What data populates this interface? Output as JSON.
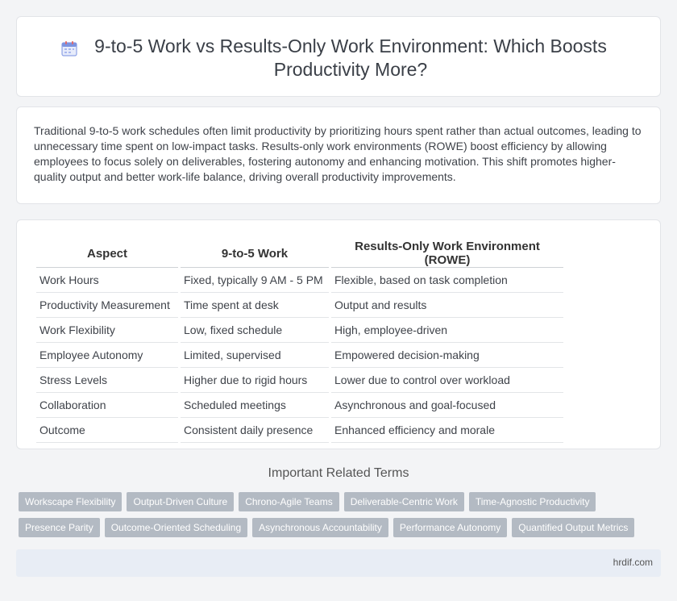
{
  "header": {
    "title": "9-to-5 Work vs Results-Only Work Environment: Which Boosts Productivity More?",
    "icon": "calendar-icon"
  },
  "intro": {
    "text": "Traditional 9-to-5 work schedules often limit productivity by prioritizing hours spent rather than actual outcomes, leading to unnecessary time spent on low-impact tasks. Results-only work environments (ROWE) boost efficiency by allowing employees to focus solely on deliverables, fostering autonomy and enhancing motivation. This shift promotes higher-quality output and better work-life balance, driving overall productivity improvements."
  },
  "table": {
    "headers": [
      "Aspect",
      "9-to-5 Work",
      "Results-Only Work Environment (ROWE)"
    ],
    "rows": [
      [
        "Work Hours",
        "Fixed, typically 9 AM - 5 PM",
        "Flexible, based on task completion"
      ],
      [
        "Productivity Measurement",
        "Time spent at desk",
        "Output and results"
      ],
      [
        "Work Flexibility",
        "Low, fixed schedule",
        "High, employee-driven"
      ],
      [
        "Employee Autonomy",
        "Limited, supervised",
        "Empowered decision-making"
      ],
      [
        "Stress Levels",
        "Higher due to rigid hours",
        "Lower due to control over workload"
      ],
      [
        "Collaboration",
        "Scheduled meetings",
        "Asynchronous and goal-focused"
      ],
      [
        "Outcome",
        "Consistent daily presence",
        "Enhanced efficiency and morale"
      ]
    ]
  },
  "related": {
    "heading": "Important Related Terms",
    "tags_row1": [
      "Workscape Flexibility",
      "Output-Driven Culture",
      "Chrono-Agile Teams",
      "Deliverable-Centric Work",
      "Time-Agnostic Productivity"
    ],
    "tags_row2": [
      "Presence Parity",
      "Outcome-Oriented Scheduling",
      "Asynchronous Accountability",
      "Performance Autonomy",
      "Quantified Output Metrics"
    ]
  },
  "footer": {
    "site": "hrdif.com"
  },
  "colors": {
    "tag_bg": "#b3bac3",
    "footer_bg": "#e8edf5",
    "page_bg": "#f3f4f6"
  }
}
